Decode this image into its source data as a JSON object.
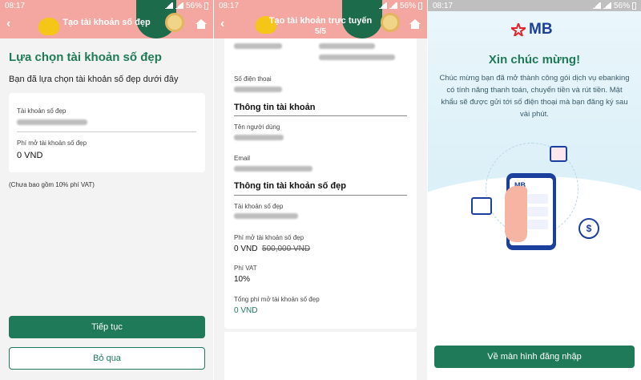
{
  "status": {
    "time": "08:17",
    "battery": "56%"
  },
  "screen1": {
    "header_title": "Tạo tài khoản số đẹp",
    "heading": "Lựa chọn tài khoản số đẹp",
    "intro": "Bạn đã lựa chọn tài khoản số đẹp dưới đây",
    "account_label": "Tài khoản số đẹp",
    "fee_label": "Phí mở tài khoản số đẹp",
    "fee_value": "0 VND",
    "vat_note": "(Chưa bao gồm 10% phí VAT)",
    "continue_label": "Tiếp tục",
    "skip_label": "Bỏ qua"
  },
  "screen2": {
    "header_title": "Tạo tài khoản trực tuyến",
    "step": "5/5",
    "phone_label": "Số điện thoại",
    "account_info_title": "Thông tin tài khoản",
    "username_label": "Tên người dùng",
    "email_label": "Email",
    "pretty_info_title": "Thông tin tài khoản số đẹp",
    "pretty_account_label": "Tài khoản số đẹp",
    "open_fee_label": "Phí mở tài khoản số đẹp",
    "open_fee_value": "0 VND",
    "open_fee_old": "500,000 VND",
    "vat_label": "Phí VAT",
    "vat_value": "10%",
    "total_label": "Tổng phí mở tài khoản số đẹp",
    "total_value": "0 VND"
  },
  "screen3": {
    "brand": "MB",
    "title": "Xin chúc mừng!",
    "message": "Chúc mừng bạn đã mở thành công gói dịch vụ ebanking có tính năng thanh toán, chuyển tiền và rút tiền. Mật khẩu sẽ được gửi tới số điện thoại mà bạn đăng ký sau vài phút.",
    "phone_brand": "MB",
    "login_button": "Về màn hình đăng nhập"
  },
  "colors": {
    "primary": "#1e7a59",
    "header": "#f4a7a0",
    "brand_blue": "#1b3f9c",
    "brand_red": "#e3262d"
  }
}
